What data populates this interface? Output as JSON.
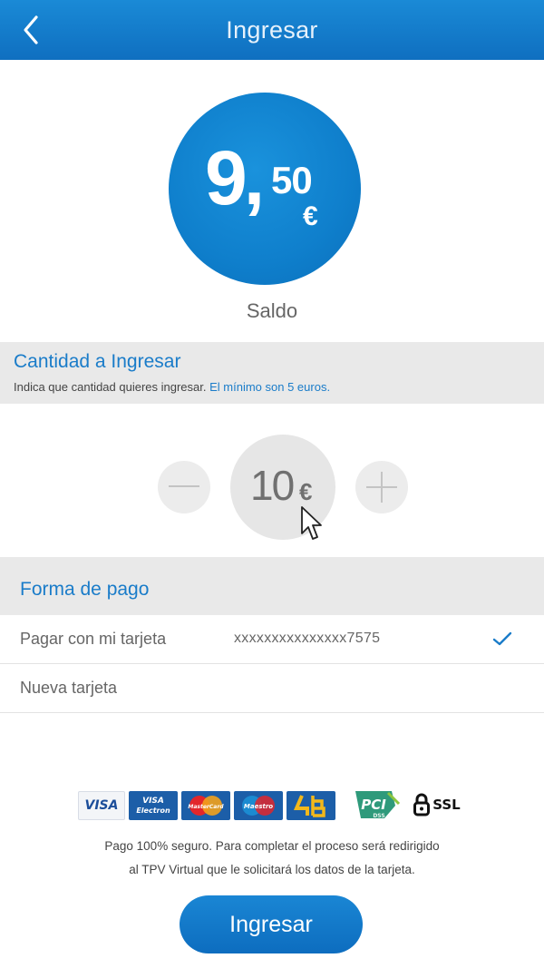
{
  "header": {
    "title": "Ingresar",
    "back_icon": "chevron-left-icon"
  },
  "balance": {
    "integer": "9,",
    "decimal": "50",
    "currency": "€",
    "label": "Saldo"
  },
  "amount_section": {
    "title": "Cantidad a Ingresar",
    "subtitle": "Indica que cantidad quieres ingresar.",
    "subtitle_highlight": "El mínimo son 5 euros."
  },
  "stepper": {
    "value": "10",
    "currency": "€",
    "minus_icon": "minus-icon",
    "plus_icon": "plus-icon"
  },
  "payment": {
    "title": "Forma de pago",
    "options": [
      {
        "label": "Pagar con mi tarjeta",
        "card": "xxxxxxxxxxxxxxx7575",
        "selected": true
      },
      {
        "label": "Nueva tarjeta",
        "selected": false
      }
    ]
  },
  "logos": {
    "visa": "VISA",
    "visa_electron_1": "VISA",
    "visa_electron_2": "Electron",
    "mastercard": "MasterCard",
    "maestro": "Maestro",
    "pci_1": "PCI",
    "pci_2": "DSS",
    "ssl": "SSL"
  },
  "secure_text": {
    "line1": "Pago 100% seguro. Para completar el proceso será redirigido",
    "line2": "al TPV Virtual que le solicitará los datos de la tarjeta."
  },
  "submit_label": "Ingresar",
  "colors": {
    "primary": "#1077c6",
    "accent_text": "#1a7cc9",
    "section_bg": "#e9e9e9"
  }
}
